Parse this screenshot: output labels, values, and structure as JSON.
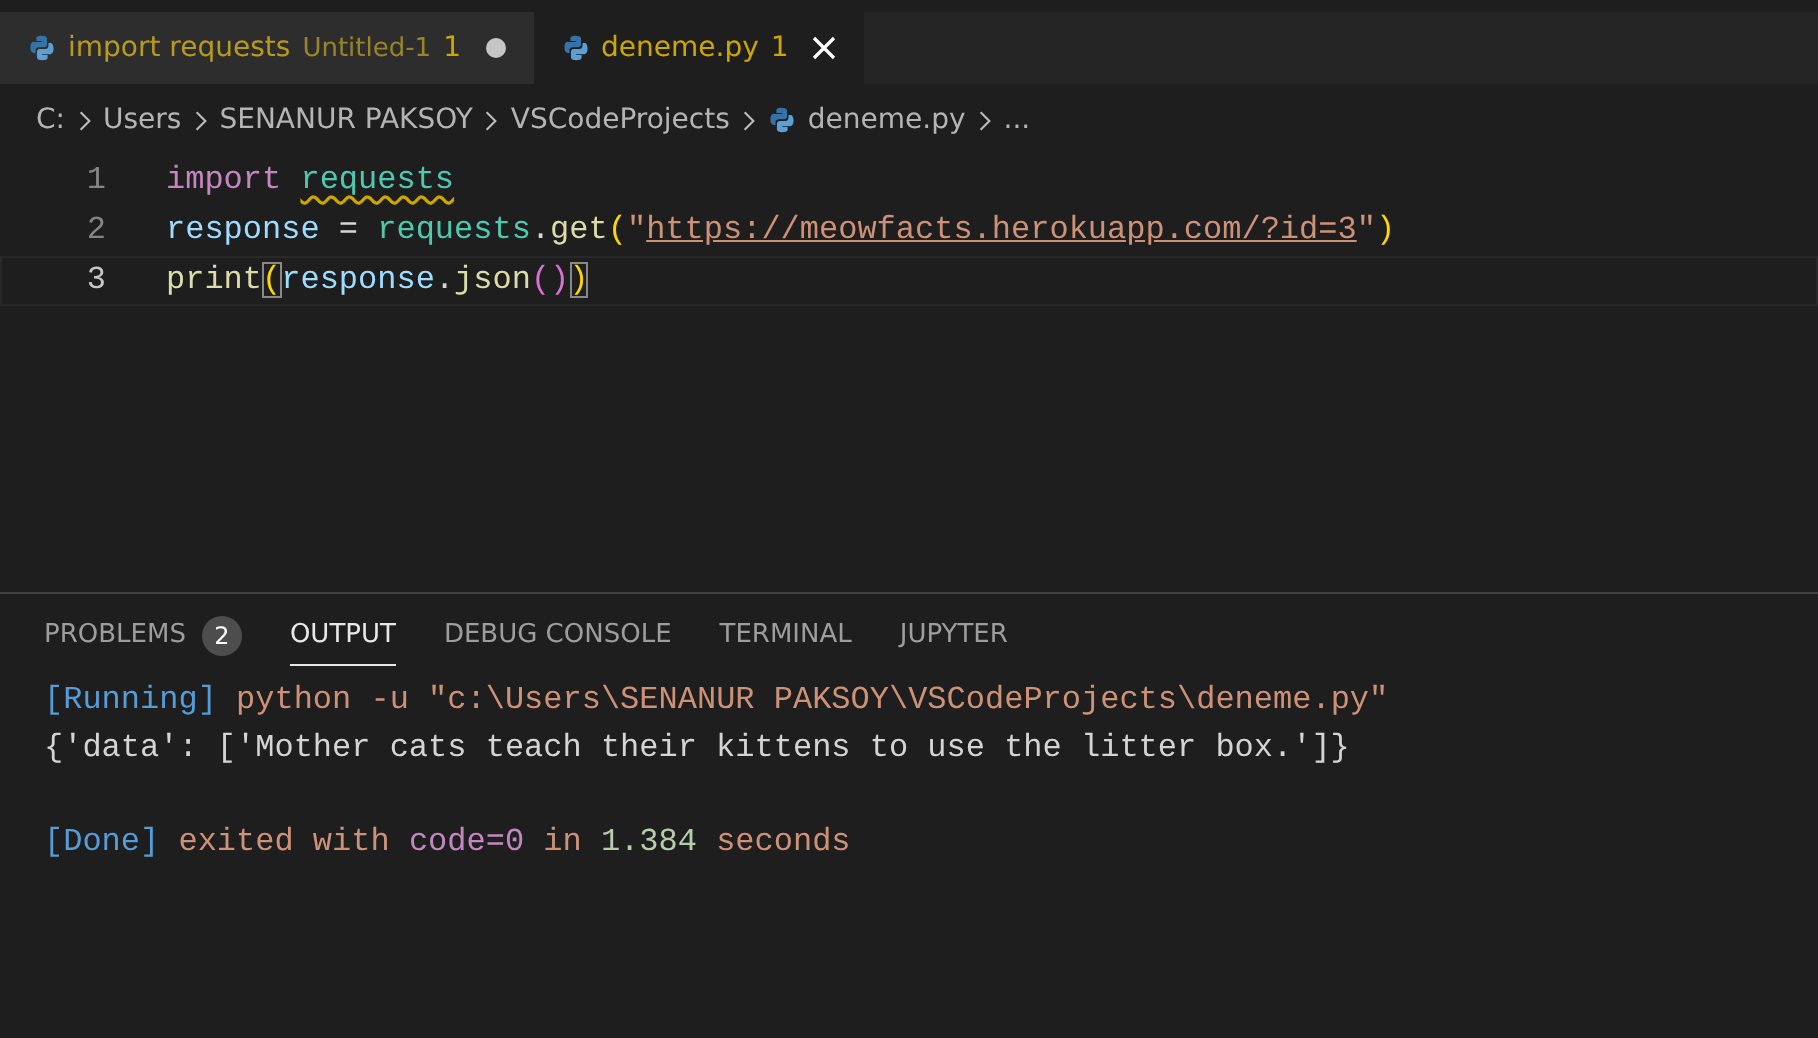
{
  "tabs": [
    {
      "name": "import requests",
      "description": "Untitled-1",
      "problems": "1",
      "selected": false,
      "dirty": true
    },
    {
      "name": "deneme.py",
      "problems": "1",
      "selected": true,
      "dirty": false
    }
  ],
  "breadcrumb": [
    {
      "text": "C:",
      "kind": "folder"
    },
    {
      "text": "Users",
      "kind": "folder"
    },
    {
      "text": "SENANUR PAKSOY",
      "kind": "folder"
    },
    {
      "text": "VSCodeProjects",
      "kind": "folder"
    },
    {
      "text": "deneme.py",
      "kind": "file"
    },
    {
      "text": "...",
      "kind": "symbol"
    }
  ],
  "editor": {
    "lines": [
      {
        "number": "1",
        "current": false,
        "tokens": [
          {
            "text": "import ",
            "kind": "keyword",
            "warning": false,
            "matched": false
          },
          {
            "text": "requests",
            "kind": "module",
            "warning": true,
            "matched": false
          }
        ]
      },
      {
        "number": "2",
        "current": false,
        "tokens": [
          {
            "text": "response",
            "kind": "variable",
            "warning": false,
            "matched": false
          },
          {
            "text": " = ",
            "kind": "plain",
            "warning": false,
            "matched": false
          },
          {
            "text": "requests",
            "kind": "module",
            "warning": false,
            "matched": false
          },
          {
            "text": ".",
            "kind": "plain",
            "warning": false,
            "matched": false
          },
          {
            "text": "get",
            "kind": "function",
            "warning": false,
            "matched": false
          },
          {
            "text": "(",
            "kind": "bracket1",
            "warning": false,
            "matched": false
          },
          {
            "text": "\"",
            "kind": "string",
            "warning": false,
            "matched": false
          },
          {
            "text": "https://meowfacts.herokuapp.com/?id=3",
            "kind": "link",
            "warning": false,
            "matched": false
          },
          {
            "text": "\"",
            "kind": "string",
            "warning": false,
            "matched": false
          },
          {
            "text": ")",
            "kind": "bracket1",
            "warning": false,
            "matched": false
          }
        ]
      },
      {
        "number": "3",
        "current": true,
        "tokens": [
          {
            "text": "print",
            "kind": "function",
            "warning": false,
            "matched": false
          },
          {
            "text": "(",
            "kind": "bracket1",
            "warning": false,
            "matched": true
          },
          {
            "text": "response",
            "kind": "variable",
            "warning": false,
            "matched": false
          },
          {
            "text": ".",
            "kind": "plain",
            "warning": false,
            "matched": false
          },
          {
            "text": "json",
            "kind": "function",
            "warning": false,
            "matched": false
          },
          {
            "text": "()",
            "kind": "bracket2",
            "warning": false,
            "matched": false
          },
          {
            "text": ")",
            "kind": "bracket1",
            "warning": false,
            "matched": true
          }
        ]
      }
    ]
  },
  "panel": {
    "tabs": [
      {
        "label": "PROBLEMS",
        "badge": "2",
        "selected": false
      },
      {
        "label": "OUTPUT",
        "selected": true
      },
      {
        "label": "DEBUG CONSOLE",
        "selected": false
      },
      {
        "label": "TERMINAL",
        "selected": false
      },
      {
        "label": "JUPYTER",
        "selected": false
      }
    ],
    "output": [
      {
        "tokens": [
          {
            "text": "[Running]",
            "kind": "tag"
          },
          {
            "text": " python -u \"c:\\Users\\SENANUR PAKSOY\\VSCodeProjects\\deneme.py\"",
            "kind": "string"
          }
        ]
      },
      {
        "tokens": [
          {
            "text": "{'data': ['Mother cats teach their kittens to use the litter box.']}",
            "kind": "plain"
          }
        ]
      },
      {
        "blank": true
      },
      {
        "tokens": [
          {
            "text": "[Done]",
            "kind": "tag"
          },
          {
            "text": " exited with ",
            "kind": "string"
          },
          {
            "text": "code=0",
            "kind": "keyword"
          },
          {
            "text": " in ",
            "kind": "string"
          },
          {
            "text": "1.384",
            "kind": "number"
          },
          {
            "text": " seconds",
            "kind": "string"
          }
        ]
      }
    ]
  }
}
